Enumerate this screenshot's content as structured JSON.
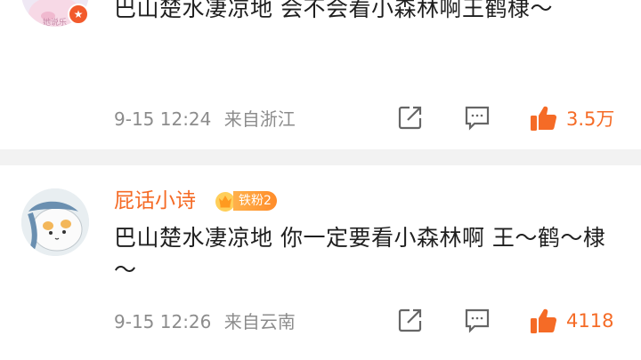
{
  "comments": [
    {
      "content": "巴山楚水凄凉地 会不会看小森林啊王鹤棣～",
      "date": "9-15 12:24",
      "location": "来自浙江",
      "likes": "3.5万"
    },
    {
      "username": "屁话小诗",
      "badge": "铁粉2",
      "content": "巴山楚水凄凉地 你一定要看小森林啊 王～鹤～棣～",
      "date": "9-15 12:26",
      "location": "来自云南",
      "likes": "4118"
    }
  ],
  "colors": {
    "accent": "#f56b26",
    "meta": "#8c8c8c",
    "divider": "#f2f2f2"
  },
  "icons": [
    "verified-badge-icon",
    "crown-icon",
    "share-icon",
    "comment-icon",
    "thumbs-up-icon"
  ]
}
